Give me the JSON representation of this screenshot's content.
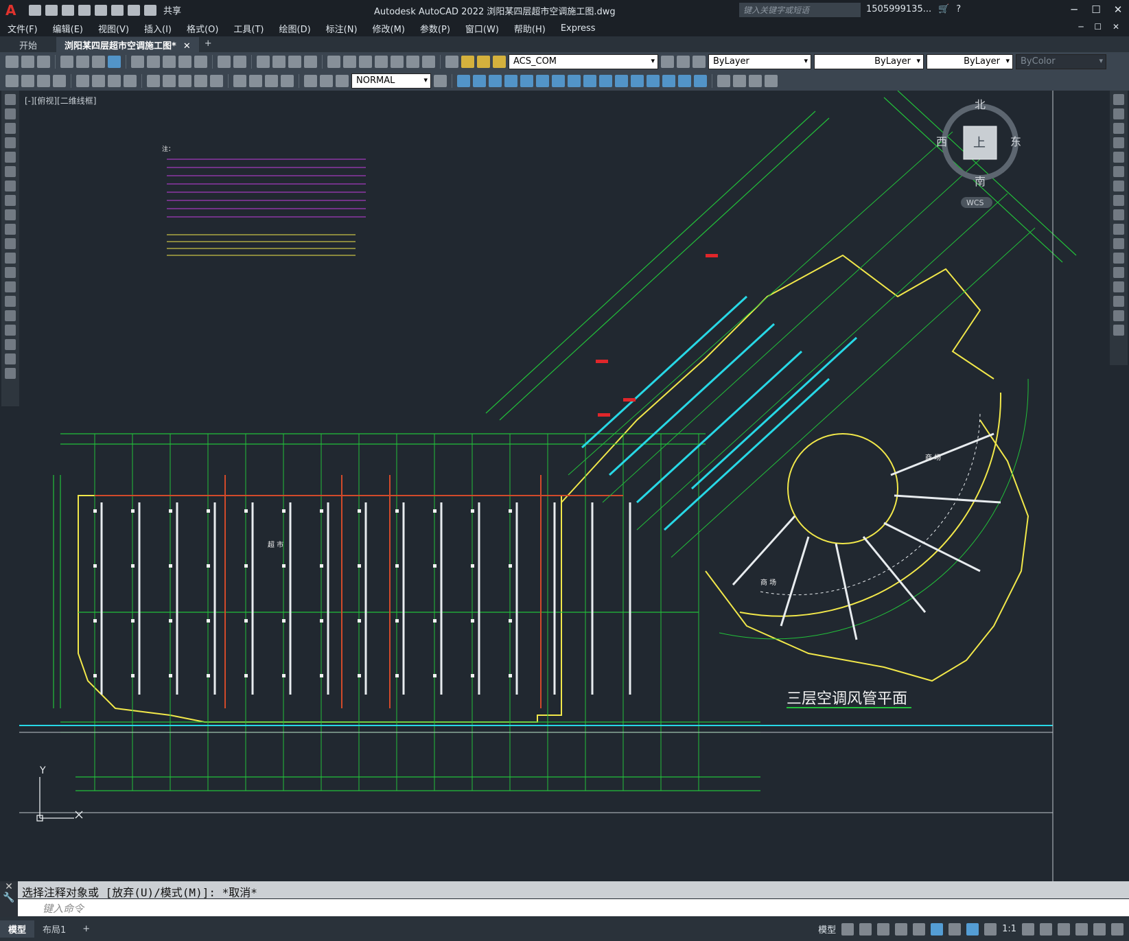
{
  "title_bar": {
    "logo": "A",
    "share_label": "共享",
    "app_title": "Autodesk AutoCAD 2022    浏阳某四层超市空调施工图.dwg",
    "search_placeholder": "键入关键字或短语",
    "user": "1505999135...",
    "win_min": "─",
    "win_max": "☐",
    "win_close": "✕"
  },
  "menu": {
    "items": [
      "文件(F)",
      "编辑(E)",
      "视图(V)",
      "插入(I)",
      "格式(O)",
      "工具(T)",
      "绘图(D)",
      "标注(N)",
      "修改(M)",
      "参数(P)",
      "窗口(W)",
      "帮助(H)",
      "Express"
    ],
    "doc_controls": "─ ☐ ✕"
  },
  "tabs": {
    "start": "开始",
    "active_doc": "浏阳某四层超市空调施工图*",
    "close": "✕",
    "add": "+"
  },
  "toolbar": {
    "layer": "ACS_COM",
    "color": "ByLayer",
    "linetype": "ByLayer",
    "lineweight": "ByLayer",
    "plotstyle": "ByColor",
    "dimstyle": "NORMAL"
  },
  "viewport": {
    "label": "[-][俯视][二维线框]",
    "compass": {
      "north": "北",
      "south": "南",
      "east": "东",
      "west": "西",
      "top": "上",
      "ucs": "WCS"
    },
    "ucs_y": "Y"
  },
  "drawing": {
    "title": "三层空调风管平面",
    "room_supermarket": "超  市",
    "room_shop1": "商  场",
    "room_shop2": "商  场",
    "notes_heading": "注："
  },
  "command": {
    "history": "选择注释对象或 [放弃(U)/模式(M)]: *取消*",
    "placeholder": "键入命令"
  },
  "status": {
    "layout_tabs": [
      "模型",
      "布局1"
    ],
    "add": "+",
    "model_label": "模型",
    "scale": "1:1"
  }
}
